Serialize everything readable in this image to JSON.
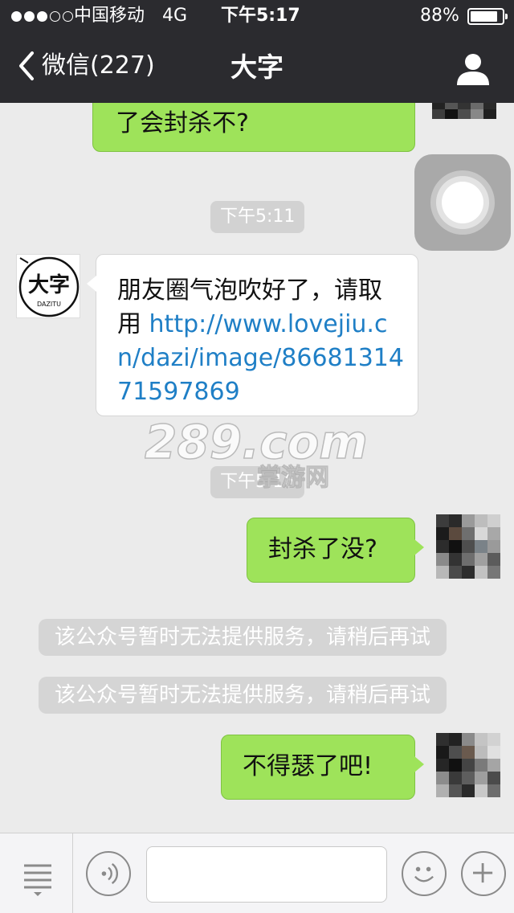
{
  "status_bar": {
    "carrier": "中国移动",
    "network": "4G",
    "time": "下午5:17",
    "battery_pct": "88%",
    "battery_level": 0.88,
    "signal_bars_filled": 3,
    "signal_bars_total": 5
  },
  "nav": {
    "back_label": "微信(227)",
    "title": "大字",
    "back_icon": "chevron-left-icon",
    "profile_icon": "person-icon"
  },
  "messages": {
    "m1": {
      "text": "了会封杀不?"
    },
    "t1": "下午5:11",
    "m2": {
      "text": "朋友圈气泡吹好了，请取\n用 ",
      "link": "http://www.lovejiu.c\nn/dazi/image/86681314\n71597869"
    },
    "official_avatar": {
      "line1": "大字",
      "line2": "DAZITU"
    },
    "t2": "下午5:16",
    "m3": {
      "text": "封杀了没?"
    },
    "sys1": "该公众号暂时无法提供服务，请稍后再试",
    "sys2": "该公众号暂时无法提供服务，请稍后再试",
    "m4": {
      "text": "不得瑟了吧!"
    }
  },
  "watermark": {
    "line1": "289.com",
    "line2": "掌游网"
  },
  "input_bar": {
    "menu_icon": "list-menu-icon",
    "voice_icon": "voice-icon",
    "emoji_icon": "smiley-icon",
    "add_icon": "plus-icon",
    "placeholder": ""
  },
  "colors": {
    "nav_bg": "#2b2b2f",
    "chat_bg": "#ebebeb",
    "outgoing_bubble": "#9ee35a",
    "incoming_bubble": "#ffffff",
    "link": "#1f7fc6"
  }
}
